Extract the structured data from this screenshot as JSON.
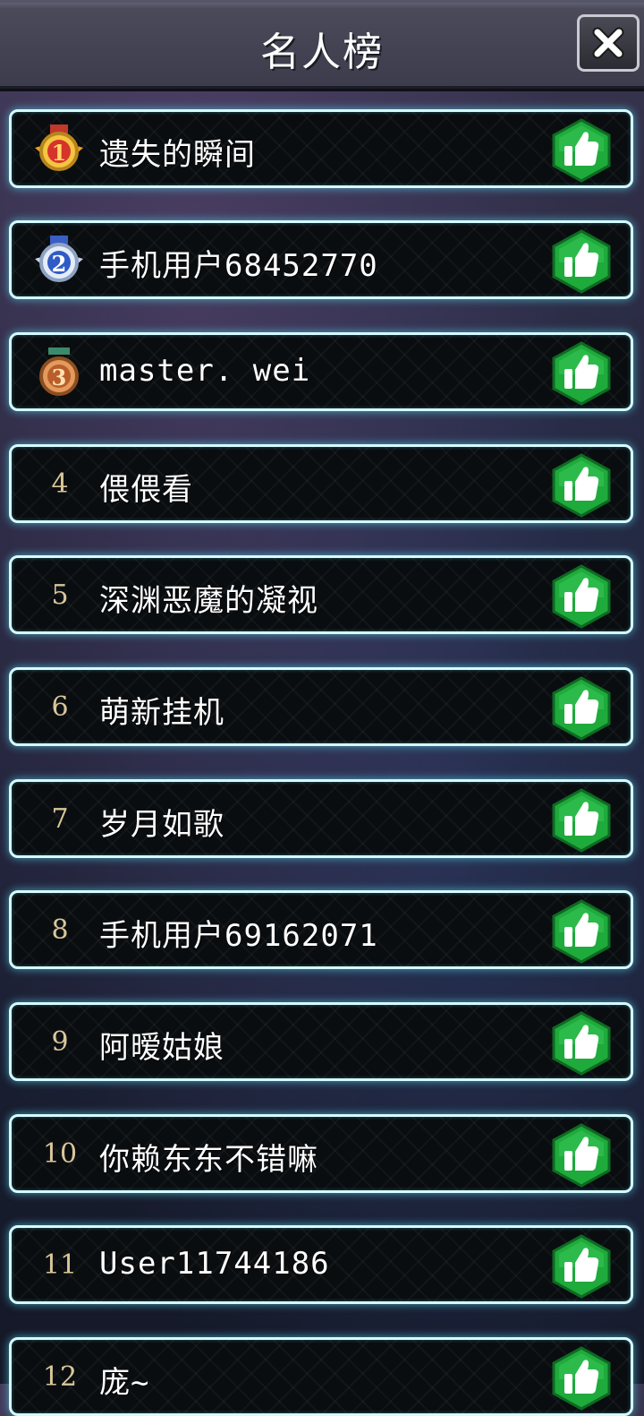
{
  "header": {
    "title": "名人榜"
  },
  "rows": [
    {
      "rank": "1",
      "name": "遗失的瞬间"
    },
    {
      "rank": "2",
      "name": "手机用户68452770"
    },
    {
      "rank": "3",
      "name": "master. wei"
    },
    {
      "rank": "4",
      "name": "偎偎看"
    },
    {
      "rank": "5",
      "name": "深渊恶魔的凝视"
    },
    {
      "rank": "6",
      "name": "萌新挂机"
    },
    {
      "rank": "7",
      "name": "岁月如歌"
    },
    {
      "rank": "8",
      "name": "手机用户69162071"
    },
    {
      "rank": "9",
      "name": "阿暧姑娘"
    },
    {
      "rank": "10",
      "name": "你赖东东不错嘛"
    },
    {
      "rank": "11",
      "name": "User11744186"
    },
    {
      "rank": "12",
      "name": "庞~"
    }
  ],
  "icons": {
    "close": "close-icon",
    "like": "thumbs-up-icon",
    "medal_gold": "gold-medal-icon",
    "medal_silver": "silver-medal-icon",
    "medal_bronze": "bronze-medal-icon"
  },
  "colors": {
    "like_green": "#1faa3c",
    "row_border": "#d6fbff",
    "rank_text": "#d9c79a"
  }
}
